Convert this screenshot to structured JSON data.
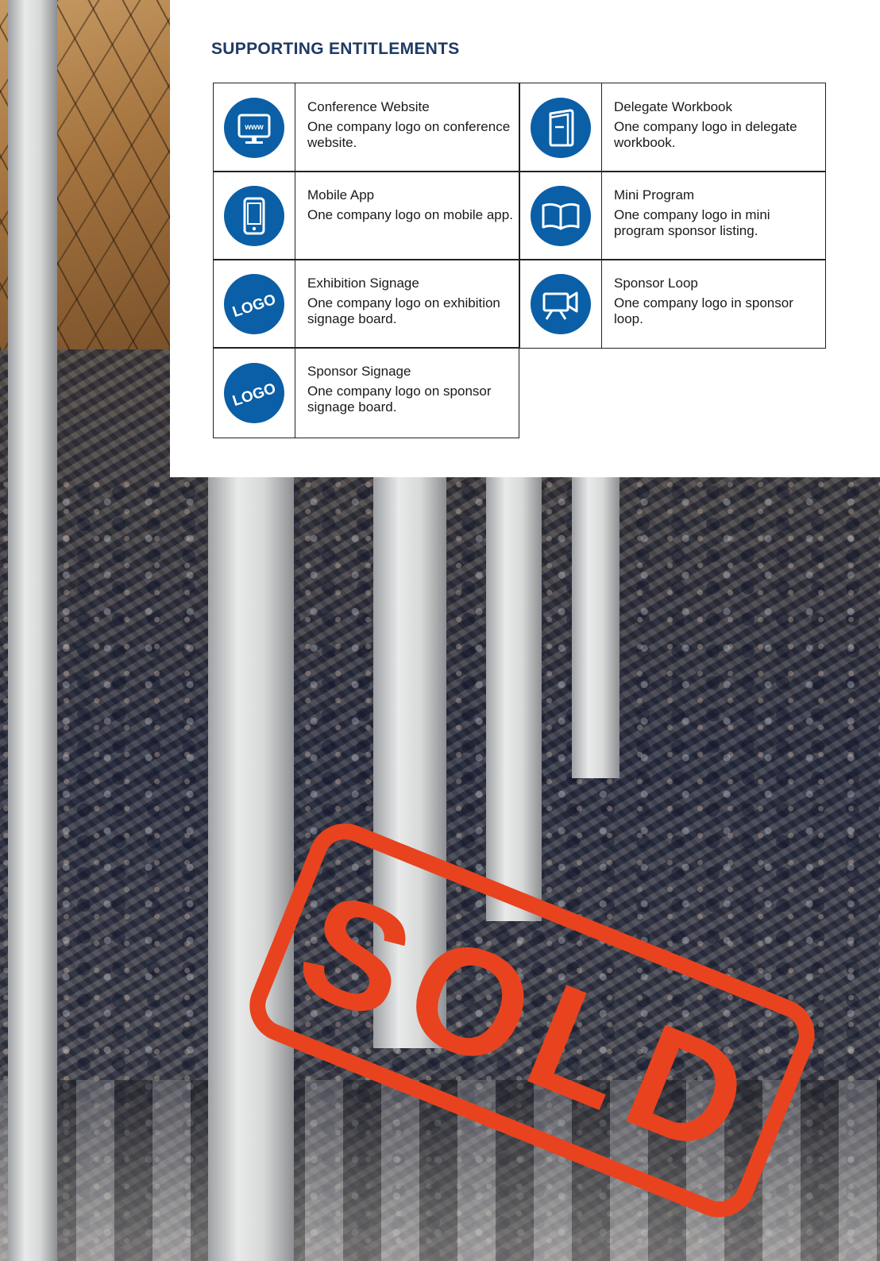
{
  "heading": "SUPPORTING ENTITLEMENTS",
  "accent_color": "#0a5fa6",
  "heading_color": "#1f3a64",
  "stamp_color": "#e8431e",
  "entitlements": [
    {
      "title": "Conference Website",
      "desc": "One company logo on conference website.",
      "icon": "website-monitor-icon",
      "icon_text": "www"
    },
    {
      "title": "Delegate Workbook",
      "desc": "One company logo in delegate workbook.",
      "icon": "workbook-icon"
    },
    {
      "title": "Mobile App",
      "desc": "One company logo on mobile app.",
      "icon": "mobile-phone-icon"
    },
    {
      "title": "Mini Program",
      "desc": "One company logo in mini program sponsor listing.",
      "icon": "open-book-icon"
    },
    {
      "title": "Exhibition Signage",
      "desc": "One company logo on exhibition signage board.",
      "icon": "logo-badge-icon",
      "icon_text": "LOGO"
    },
    {
      "title": "Sponsor Loop",
      "desc": "One company logo in sponsor loop.",
      "icon": "video-camera-icon"
    },
    {
      "title": "Sponsor Signage",
      "desc": "One company logo on sponsor signage board.",
      "icon": "logo-badge-icon",
      "icon_text": "LOGO"
    }
  ],
  "stamp": "SOLD"
}
